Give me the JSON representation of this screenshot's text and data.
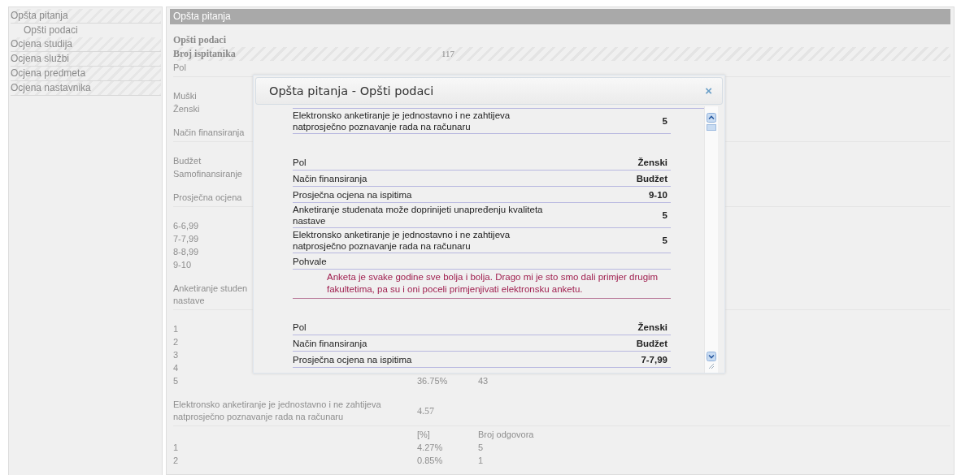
{
  "sidebar": {
    "items": [
      {
        "label": "Opšta pitanja",
        "children": [
          {
            "label": "Opšti podaci"
          }
        ]
      },
      {
        "label": "Ocjena studija"
      },
      {
        "label": "Ocjena službi"
      },
      {
        "label": "Ocjena predmeta"
      },
      {
        "label": "Ocjena nastavnika"
      }
    ]
  },
  "main": {
    "title": "Opšta pitanja",
    "heading": "Opšti podaci",
    "count": {
      "label": "Broj ispitanika",
      "value": "117"
    },
    "questions": [
      {
        "lines": [
          "Pol"
        ],
        "options": [
          {
            "label": "Muški"
          },
          {
            "label": "Ženski"
          }
        ]
      },
      {
        "lines": [
          "Način finansiranja"
        ],
        "options": [
          {
            "label": "Budžet"
          },
          {
            "label": "Samofinansiranje"
          }
        ]
      },
      {
        "lines": [
          "Prosječna ocjena"
        ],
        "options": [
          {
            "label": "6-6,99"
          },
          {
            "label": "7-7,99"
          },
          {
            "label": "8-8,99"
          },
          {
            "label": "9-10"
          }
        ]
      },
      {
        "lines": [
          "Anketiranje studen",
          "nastave"
        ],
        "options": [
          {
            "label": "1"
          },
          {
            "label": "2"
          },
          {
            "label": "3"
          },
          {
            "label": "4"
          },
          {
            "label": "5",
            "cells": [
              "36.75%",
              "43"
            ]
          }
        ]
      },
      {
        "lines": [
          "Elektronsko anketiranje je jednostavno i ne zahtijeva",
          "natprosječno poznavanje rada na računaru"
        ],
        "value": "4.57",
        "table_header": [
          "[%]",
          "Broj odgovora"
        ],
        "options": [
          {
            "label": "1",
            "cells": [
              "4.27%",
              "5"
            ]
          },
          {
            "label": "2",
            "cells": [
              "0.85%",
              "1"
            ]
          }
        ]
      }
    ]
  },
  "dialog": {
    "title": "Opšta pitanja - Opšti podaci",
    "close": "×",
    "groups": [
      {
        "rows": [
          {
            "label": "Elektronsko anketiranje je jednostavno i ne zahtijeva natprosječno poznavanje rada na računaru",
            "value": "5"
          }
        ]
      },
      {
        "rows": [
          {
            "label": "Pol",
            "value": "Ženski"
          },
          {
            "label": "Način finansiranja",
            "value": "Budžet"
          },
          {
            "label": "Prosječna ocjena na ispitima",
            "value": "9-10"
          },
          {
            "label": "Anketiranje studenata može doprinijeti unapređenju kvaliteta nastave",
            "value": "5"
          },
          {
            "label": "Elektronsko anketiranje je jednostavno i ne zahtijeva natprosječno poznavanje rada na računaru",
            "value": "5"
          }
        ],
        "comment": {
          "label": "Pohvale",
          "text": "Anketa je svake godine sve bolja i bolja. Drago mi je sto smo dali primjer drugim fakultetima, pa su i oni poceli primjenjivati elektronsku anketu."
        }
      },
      {
        "rows": [
          {
            "label": "Pol",
            "value": "Ženski"
          },
          {
            "label": "Način finansiranja",
            "value": "Budžet"
          },
          {
            "label": "Prosječna ocjena na ispitima",
            "value": "7-7,99"
          }
        ]
      }
    ]
  }
}
